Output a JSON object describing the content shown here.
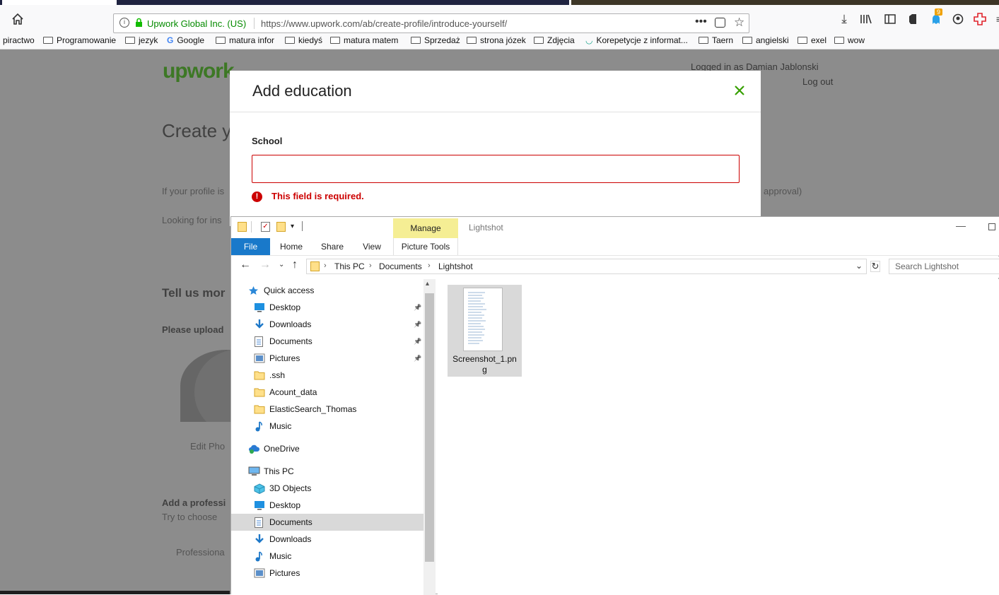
{
  "browser": {
    "site_identity": "Upwork Global Inc. (US)",
    "url": "https://www.upwork.com/ab/create-profile/introduce-yourself/",
    "badge_count": "9"
  },
  "bookmarks": [
    "piractwo",
    "Programowanie",
    "jezyk",
    "Google",
    "matura infor",
    "kiedyś",
    "matura matem",
    "Sprzedaż",
    "strona józek",
    "Zdjęcia",
    "Korepetycje z informat...",
    "Taern",
    "angielski",
    "exel",
    "wow"
  ],
  "page": {
    "logo": "upwork",
    "logged_in": "Logged in as Damian Jablonski",
    "logout": "Log out",
    "heading": "Create y",
    "profile_text": "If your profile is",
    "approval_text": "approval)",
    "looking_text": "Looking for ins",
    "tell_us": "Tell us mor",
    "please_upload": "Please upload",
    "edit_photo": "Edit Pho",
    "add_professional": "Add a professi",
    "try_choose": "Try to choose",
    "professional": "Professiona"
  },
  "modal": {
    "title": "Add education",
    "close_icon": "close-icon",
    "school_label": "School",
    "school_value": "",
    "error": "This field is required."
  },
  "explorer": {
    "context_tab": "Manage",
    "window_title": "Lightshot",
    "tabs": [
      "File",
      "Home",
      "Share",
      "View",
      "Picture Tools"
    ],
    "breadcrumb": [
      "This PC",
      "Documents",
      "Lightshot"
    ],
    "search_placeholder": "Search Lightshot",
    "nav": [
      {
        "label": "Quick access",
        "icon": "star-icon",
        "indent": 0,
        "pinned": false,
        "selected": false
      },
      {
        "label": "Desktop",
        "icon": "desktop-icon",
        "indent": 1,
        "pinned": true,
        "selected": false
      },
      {
        "label": "Downloads",
        "icon": "download-icon",
        "indent": 1,
        "pinned": true,
        "selected": false
      },
      {
        "label": "Documents",
        "icon": "document-icon",
        "indent": 1,
        "pinned": true,
        "selected": false
      },
      {
        "label": "Pictures",
        "icon": "pictures-icon",
        "indent": 1,
        "pinned": true,
        "selected": false
      },
      {
        "label": ".ssh",
        "icon": "folder-icon",
        "indent": 1,
        "pinned": false,
        "selected": false
      },
      {
        "label": "Acount_data",
        "icon": "folder-icon",
        "indent": 1,
        "pinned": false,
        "selected": false
      },
      {
        "label": "ElasticSearch_Thomas",
        "icon": "folder-icon",
        "indent": 1,
        "pinned": false,
        "selected": false
      },
      {
        "label": "Music",
        "icon": "music-icon",
        "indent": 1,
        "pinned": false,
        "selected": false
      },
      {
        "label": "OneDrive",
        "icon": "cloud-icon",
        "indent": 0,
        "pinned": false,
        "selected": false
      },
      {
        "label": "This PC",
        "icon": "computer-icon",
        "indent": 0,
        "pinned": false,
        "selected": false
      },
      {
        "label": "3D Objects",
        "icon": "cube-icon",
        "indent": 1,
        "pinned": false,
        "selected": false
      },
      {
        "label": "Desktop",
        "icon": "desktop-icon",
        "indent": 1,
        "pinned": false,
        "selected": false
      },
      {
        "label": "Documents",
        "icon": "document-icon",
        "indent": 1,
        "pinned": false,
        "selected": true
      },
      {
        "label": "Downloads",
        "icon": "download-icon",
        "indent": 1,
        "pinned": false,
        "selected": false
      },
      {
        "label": "Music",
        "icon": "music-icon",
        "indent": 1,
        "pinned": false,
        "selected": false
      },
      {
        "label": "Pictures",
        "icon": "pictures-icon",
        "indent": 1,
        "pinned": false,
        "selected": false
      }
    ],
    "file": {
      "name": "Screenshot_1.png"
    }
  },
  "colors": {
    "upwork_green": "#37a000",
    "error_red": "#cc0000",
    "file_tab_blue": "#1979ca",
    "manage_tab_yellow": "#f5ee94"
  }
}
